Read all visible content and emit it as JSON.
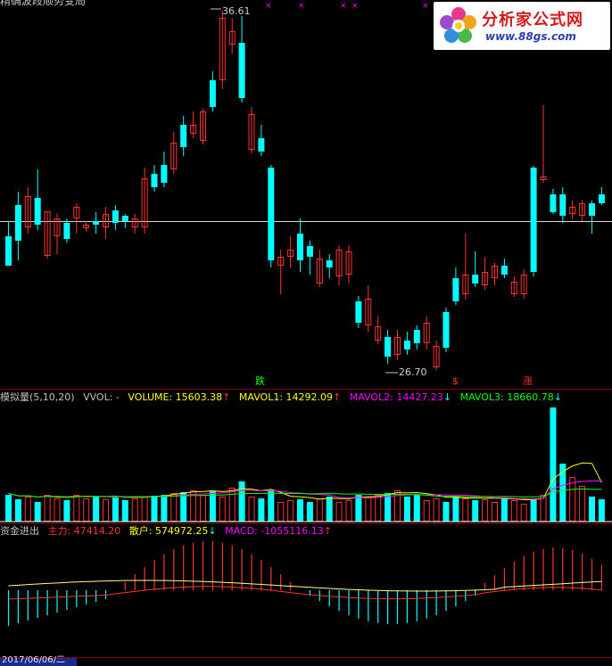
{
  "watermark": {
    "title": "分析家公式网",
    "url": "www.88gs.com"
  },
  "top_title": "精确波段顺势变局",
  "price_panel": {
    "high_label": "36.61",
    "low_label": "26.70",
    "signal_down": "跌",
    "signal_up": "涨",
    "signal_dollar": "$"
  },
  "volume_panel": {
    "name": "模拟量(5,10,20)",
    "vvol": "VVOL: -",
    "volume": "VOLUME: 15603.38",
    "mavol1": "MAVOL1: 14292.09",
    "mavol2": "MAVOL2: 14427.23",
    "mavol3": "MAVOL3: 18660.78",
    "colors": {
      "volume": "#ffff00",
      "mavol1": "#ffff00",
      "mavol2": "#ff00ff",
      "mavol3": "#00ff00"
    }
  },
  "macd_panel": {
    "name": "资金进出",
    "main_force": "主力: 47414.20",
    "retail": "散户: 574972.25",
    "macd": "MACD: -1055116.13"
  },
  "date_label": "2017/06/06/二",
  "colors": {
    "up": "#ff3232",
    "down": "#00ffff",
    "bg": "#000000",
    "grid": "#800000"
  }
}
